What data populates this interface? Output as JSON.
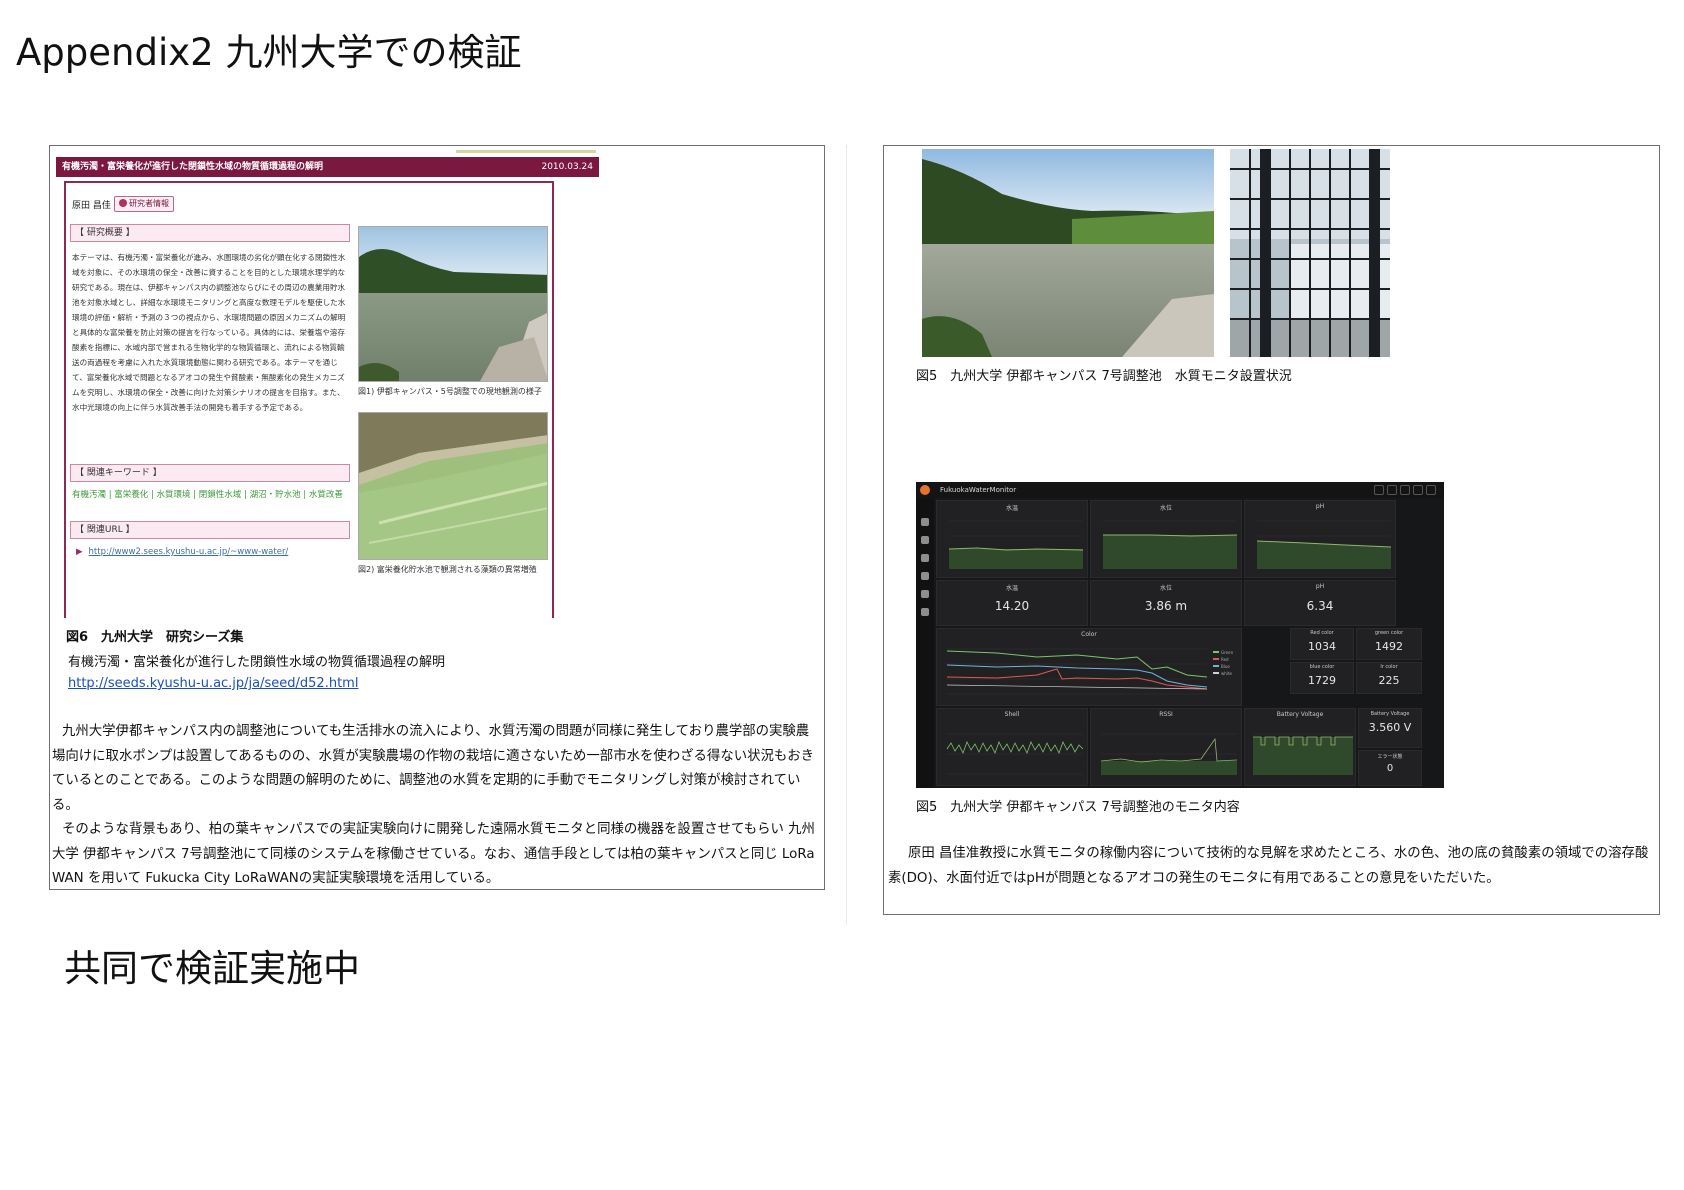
{
  "page_title": "Appendix2 九州大学での検証",
  "footer": "共同で検証実施中",
  "left": {
    "screenshot": {
      "header_title": "有機汚濁・富栄養化が進行した閉鎖性水域の物質循環過程の解明",
      "header_date": "2010.03.24",
      "researcher": "原田 昌佳",
      "researcher_button": "研究者情報",
      "sec_overview": "【 研究概要 】",
      "abstract": "本テーマは、有機汚濁・富栄養化が進み、水圏環境の劣化が顕在化する閉鎖性水域を対象に、その水環境の保全・改善に資することを目的とした環境水理学的な研究である。現在は、伊都キャンパス内の調整池ならびにその周辺の農業用貯水池を対象水域とし、詳細な水環境モニタリングと高度な数理モデルを駆使した水環境の評価・解析・予測の３つの視点から、水環境問題の原因メカニズムの解明と具体的な富栄養を防止対策の提言を行なっている。具体的には、栄養塩や溶存酸素を指標に、水域内部で営まれる生物化学的な物質循環と、流れによる物質輸送の両過程を考慮に入れた水質環境動態に関わる研究である。本テーマを通じて、富栄養化水域で問題となるアオコの発生や貧酸素・無酸素化の発生メカニズムを究明し、水環境の保全・改善に向けた対策シナリオの提言を目指す。また、水中光環境の向上に伴う水質改善手法の開発も着手する予定である。",
      "sec_keywords": "【 関連キーワード 】",
      "keywords": "有機汚濁 | 富栄養化 | 水質環境 | 閉鎖性水域 | 湖沼・貯水池 | 水質改善",
      "sec_url": "【 関連URL 】",
      "url": "http://www2.sees.kyushu-u.ac.jp/~www-water/",
      "fig1_caption": "図1) 伊都キャンパス・5号調整での現地観測の様子",
      "fig2_caption": "図2) 富栄養化貯水池で観測される藻類の異常増殖"
    },
    "fig6_title": "図6　九州大学　研究シーズ集",
    "fig6_subtitle": "有機汚濁・富栄養化が進行した閉鎖性水域の物質循環過程の解明",
    "fig6_url": "http://seeds.kyushu-u.ac.jp/ja/seed/d52.html",
    "body_p1": "九州大学伊都キャンパス内の調整池についても生活排水の流入により、水質汚濁の問題が同様に発生しており農学部の実験農場向けに取水ポンプは設置してあるものの、水質が実験農場の作物の栽培に適さないため一部市水を使わざる得ない状況もおきているとのことである。このような問題の解明のために、調整池の水質を定期的に手動でモニタリングし対策が検討されている。",
    "body_p2": "そのような背景もあり、柏の葉キャンパスでの実証実験向けに開発した遠隔水質モニタと同様の機器を設置させてもらい 九州大学 伊都キャンパス 7号調整池にて同様のシステムを稼働させている。なお、通信手段としては柏の葉キャンパスと同じ LoRa WAN を用いて Fukucka City LoRaWANの実証実験環境を活用している。"
  },
  "right": {
    "fig5_caption_1": "図5　九州大学 伊都キャンパス 7号調整池　水質モニタ設置状況",
    "fig5_caption_2": "図5　九州大学 伊都キャンパス 7号調整池のモニタ内容",
    "body": "原田 昌佳准教授に水質モニタの稼働内容について技術的な見解を求めたところ、水の色、池の底の貧酸素の領域での溶存酸素(DO)、水面付近ではpHが問題となるアオコの発生のモニタに有用であることの意見をいただいた。",
    "dashboard": {
      "name": "FukuokaWaterMonitor",
      "graph_titles": [
        "水温",
        "水位",
        "pH"
      ],
      "stat_titles": [
        "水温",
        "水位",
        "pH"
      ],
      "stats": [
        "14.20",
        "3.86 m",
        "6.34"
      ],
      "color_panel_title": "Color",
      "legend": [
        "Green",
        "Red",
        "Blue",
        "white"
      ],
      "color_titles": [
        "Red color",
        "green color",
        "blue color",
        "lr color"
      ],
      "color_values": [
        "1034",
        "1492",
        "1729",
        "225"
      ],
      "shell_title": "Shell",
      "rssi_title": "RSSI",
      "battery_title": "Battery Voltage",
      "battery_voltage_title": "Battery Voltage",
      "battery_value": "3.560 V",
      "error_title": "エラー状態",
      "error_value": "0",
      "accent_colors": {
        "grid_line": "#8fb86a",
        "green": "#7ec46a",
        "red": "#e05a4f",
        "blue": "#6fb3d8",
        "white": "#d0d0d0"
      }
    }
  }
}
